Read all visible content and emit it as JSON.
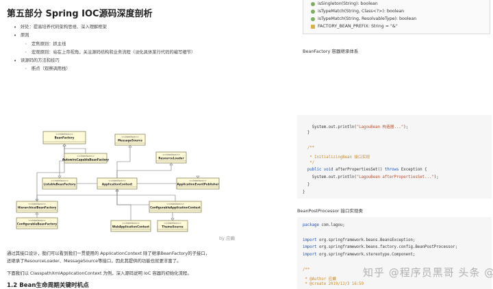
{
  "top_left": {
    "title": "第五部分 Spring IOC源码深度剖析",
    "items": [
      {
        "level": 1,
        "text": "好处：提高培养代码架构思维、深入理解框架"
      },
      {
        "level": 1,
        "text": "原则"
      },
      {
        "level": 2,
        "text": "定焦原则：抓主线"
      },
      {
        "level": 2,
        "text": "宏观原则：站在上帝视角，关注源码结构和业务流程（淡化具体某行代码的编写细节）"
      },
      {
        "level": 1,
        "text": "读源码的方法和技巧"
      },
      {
        "level": 2,
        "text": "断点（观察调用栈）"
      }
    ]
  },
  "top_right": {
    "methods": [
      {
        "icon": "method-icon",
        "text": "isSingleton(String): boolean"
      },
      {
        "icon": "method-icon",
        "text": "isTypeMatch(String, Class<?>): boolean"
      },
      {
        "icon": "method-icon",
        "text": "isTypeMatch(String, ResolvableType): boolean"
      },
      {
        "icon": "field-icon",
        "text": "FACTORY_BEAN_PREFIX: String = \"&\""
      }
    ],
    "caption": "BeanFactory 容器继承体系"
  },
  "bottom_left": {
    "uml": {
      "stereotype": "<<Interface>>",
      "boxes": [
        "BeanFactory",
        "MessageSource",
        "AutowireCapableBeanFactory",
        "ResourceLoader",
        "ListableBeanFactory",
        "ApplicationContext",
        "ApplicationEventPublisher",
        "HierarchicalBeanFactory",
        "ConfigurableApplicationContext",
        "ConfigurableBeanFactory",
        "WebApplicationContext",
        "ThemeSource"
      ]
    },
    "watermark": "by 应癫",
    "para1": [
      "通过其接口设计，我们可以看到我们一贯使用的 ApplicationContext 除了继承BeanFactory的子接口，",
      "还继承了ResourceLoader、MessageSource等接口，因此其提供的功能也就更丰富了。"
    ],
    "para2": "下面我们以 ClasspathXmlApplicationContext 为例，深入源码说明 IoC 容器的初始化流程。",
    "subhead": "1.2 Bean生命周期关键时机点"
  },
  "bottom_right": {
    "code1": [
      {
        "t": "    System.out.println(\"LagouBean 构造器...\");",
        "kind": "println"
      },
      {
        "t": "  }",
        "kind": "plain"
      },
      {
        "t": "",
        "kind": "plain"
      },
      {
        "t": "  /**",
        "kind": "comment"
      },
      {
        "t": "   * InitializingBean 接口实现",
        "kind": "comment"
      },
      {
        "t": "   */",
        "kind": "comment"
      },
      {
        "t": "  public void afterPropertiesSet() throws Exception {",
        "kind": "decl"
      },
      {
        "t": "    System.out.println(\"LagouBean afterPropertiesSet...\");",
        "kind": "println"
      },
      {
        "t": "  }",
        "kind": "plain"
      },
      {
        "t": "}",
        "kind": "plain"
      }
    ],
    "caption": "BeanPostProcessor 接口实现类",
    "code2": [
      {
        "t": "package com.lagou;",
        "kind": "pkg"
      },
      {
        "t": "",
        "kind": "plain"
      },
      {
        "t": "import org.springframework.beans.BeansException;",
        "kind": "import"
      },
      {
        "t": "import org.springframework.beans.factory.config.BeanPostProcessor;",
        "kind": "import"
      },
      {
        "t": "import org.springframework.stereotype.Component;",
        "kind": "import"
      },
      {
        "t": "",
        "kind": "plain"
      },
      {
        "t": "/**",
        "kind": "comment"
      },
      {
        "t": " * @Author 应癫",
        "kind": "comment"
      },
      {
        "t": " * @create 2019/12/3 16:59",
        "kind": "comment"
      }
    ],
    "watermark": "知乎 @程序员黑哥  头条 @Java码农之路"
  },
  "colors": {
    "uml_fill": "#fffbd9",
    "code_bg": "#f6f6f6",
    "keyword": "#1b4fb8",
    "string": "#b8502e",
    "comment": "#c98a2a"
  }
}
